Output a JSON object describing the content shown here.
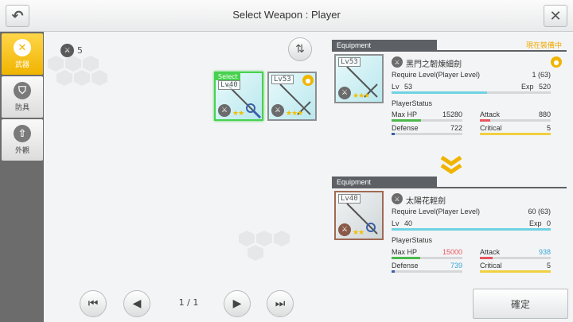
{
  "header": {
    "title": "Select Weapon : Player"
  },
  "sidebar": {
    "tabs": [
      {
        "label": "武器",
        "icon": "crossed-swords-icon",
        "active": true
      },
      {
        "label": "防具",
        "icon": "shield-icon",
        "active": false
      },
      {
        "label": "外觀",
        "icon": "up-arrow-icon",
        "active": false
      }
    ]
  },
  "inventory": {
    "count": "5"
  },
  "cards": [
    {
      "level": "Lv40",
      "select_label": "Select",
      "stars": "★★",
      "selected": true,
      "equipped": false
    },
    {
      "level": "Lv53",
      "stars": "★★★",
      "selected": false,
      "equipped": true
    }
  ],
  "current": {
    "header": "Equipment",
    "status": "現在裝備中",
    "card_level": "Lv53",
    "card_stars": "★★★",
    "name": "黑門之韌煉細劍",
    "require_label": "Require Level(Player Level)",
    "require_value": "1 (63)",
    "lv_label": "Lv",
    "lv_value": "53",
    "exp_label": "Exp",
    "exp_value": "520",
    "player_status_label": "PlayerStatus",
    "maxhp_label": "Max HP",
    "maxhp_value": "15280",
    "attack_label": "Attack",
    "attack_value": "880",
    "defense_label": "Defense",
    "defense_value": "722",
    "critical_label": "Critical",
    "critical_value": "5"
  },
  "selected": {
    "header": "Equipment",
    "card_level": "Lv40",
    "card_stars": "★★",
    "name": "太陽花輕劍",
    "require_label": "Require Level(Player Level)",
    "require_value": "60 (63)",
    "lv_label": "Lv",
    "lv_value": "40",
    "exp_label": "Exp",
    "exp_value": "0",
    "player_status_label": "PlayerStatus",
    "maxhp_label": "Max HP",
    "maxhp_value": "15000",
    "attack_label": "Attack",
    "attack_value": "938",
    "defense_label": "Defense",
    "defense_value": "739",
    "critical_label": "Critical",
    "critical_value": "5"
  },
  "pagination": {
    "indicator": "1 / 1"
  },
  "footer": {
    "confirm_label": "確定"
  },
  "colors": {
    "accent": "#f0b400",
    "selected_border": "#48d14f",
    "stat_down": "#e8555f",
    "stat_up": "#3aa7d8"
  }
}
